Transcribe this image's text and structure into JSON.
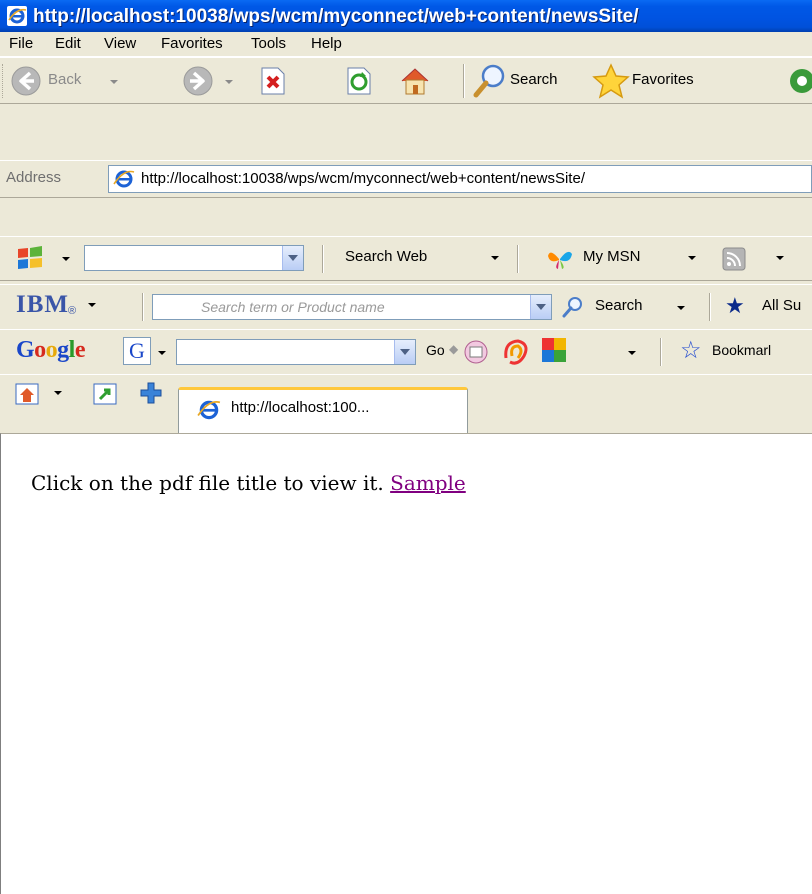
{
  "window": {
    "title": "http://localhost:10038/wps/wcm/myconnect/web+content/newsSite/"
  },
  "menu": {
    "items": [
      "File",
      "Edit",
      "View",
      "Favorites",
      "Tools",
      "Help"
    ]
  },
  "std_toolbar": {
    "back": "Back",
    "search": "Search",
    "favorites": "Favorites"
  },
  "address": {
    "label": "Address",
    "url": "http://localhost:10038/wps/wcm/myconnect/web+content/newsSite/"
  },
  "msn_toolbar": {
    "search_web": "Search Web",
    "my_msn": "My MSN"
  },
  "ibm_toolbar": {
    "logo": "IBM",
    "placeholder": "Search term or Product name",
    "search": "Search",
    "all_support": "All Su"
  },
  "google_toolbar": {
    "logo": "Google",
    "go": "Go",
    "bookmarks": "Bookmarl"
  },
  "tabs": {
    "active_title": "http://localhost:100..."
  },
  "page": {
    "text": "Click on the pdf file title to view it.",
    "link": "Sample"
  },
  "colors": {
    "titlebar": "#0054e3",
    "link_visited": "#800080",
    "tab_highlight": "#ffc83c"
  }
}
